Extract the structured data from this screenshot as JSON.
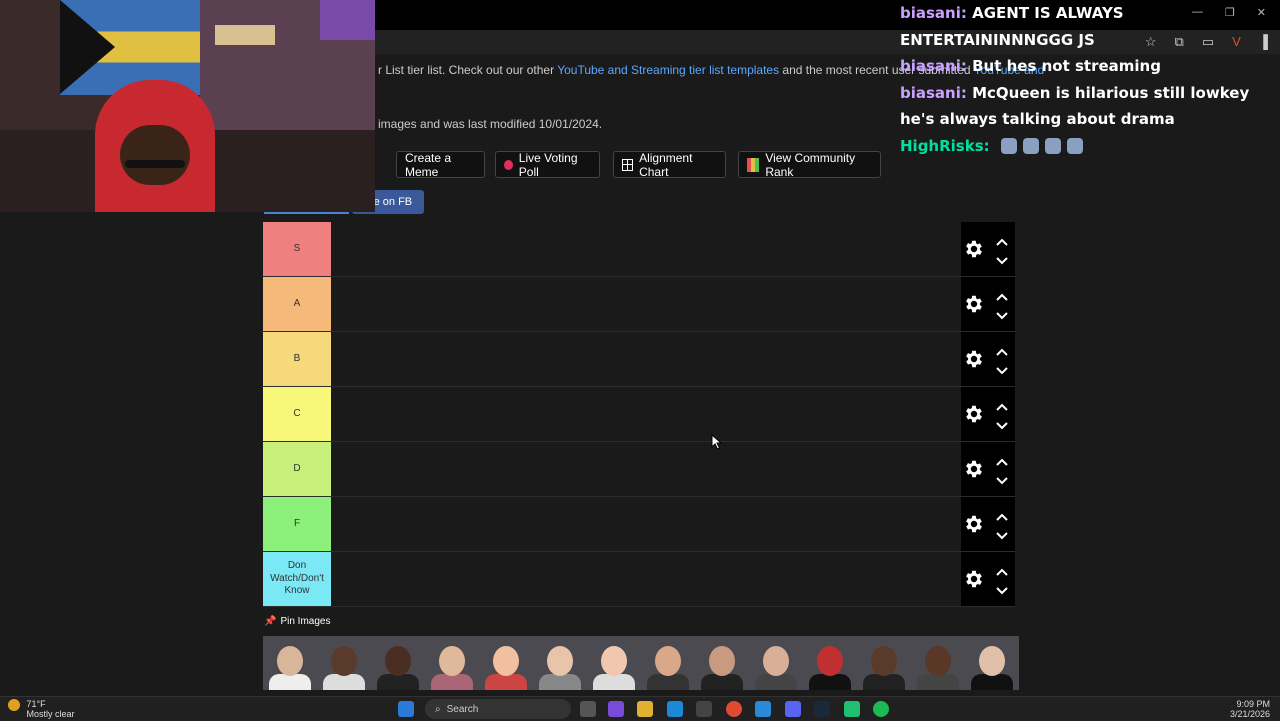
{
  "page": {
    "intro_prefix": "r List tier list. Check out our other ",
    "intro_link1": "YouTube and Streaming tier list templates",
    "intro_mid": " and the most recent user submitted ",
    "intro_link2": "YouTube and",
    "meta_text": "images and was last modified 10/01/2024."
  },
  "buttons": {
    "create_meme": "Create a Meme",
    "live_poll": "Live Voting Poll",
    "alignment": "Alignment Chart",
    "community_rank": "View Community Rank",
    "share_fb": "are on FB"
  },
  "tiers": [
    {
      "label": "S",
      "color": "#f08080"
    },
    {
      "label": "A",
      "color": "#f5b97a"
    },
    {
      "label": "B",
      "color": "#f5d97a"
    },
    {
      "label": "C",
      "color": "#f7f77a"
    },
    {
      "label": "D",
      "color": "#c9f07a"
    },
    {
      "label": "F",
      "color": "#8cf07a"
    },
    {
      "label": "Don Watch/Don't Know",
      "color": "#7ae8f5"
    }
  ],
  "pin_images": {
    "label": "Pin Images",
    "thumbs": [
      {
        "skin": "#d9b59a",
        "shirt": "#eee"
      },
      {
        "skin": "#5a3a2a",
        "shirt": "#ddd"
      },
      {
        "skin": "#4a2e22",
        "shirt": "#222"
      },
      {
        "skin": "#e0b89a",
        "shirt": "#a67"
      },
      {
        "skin": "#f0c0a0",
        "shirt": "#c44"
      },
      {
        "skin": "#e8c4a8",
        "shirt": "#888"
      },
      {
        "skin": "#f0c8b0",
        "shirt": "#ddd"
      },
      {
        "skin": "#d8a888",
        "shirt": "#333"
      },
      {
        "skin": "#c89a80",
        "shirt": "#222"
      },
      {
        "skin": "#d8b098",
        "shirt": "#444"
      },
      {
        "skin": "#c03030",
        "shirt": "#111"
      },
      {
        "skin": "#5a3a28",
        "shirt": "#222"
      },
      {
        "skin": "#5a3828",
        "shirt": "#444"
      },
      {
        "skin": "#e0c0a8",
        "shirt": "#111"
      }
    ]
  },
  "chat": [
    {
      "user": "biasani",
      "color": "#c8a2ff",
      "text": "AGENT IS ALWAYS ENTERTAININNNGGG JS"
    },
    {
      "user": "biasani",
      "color": "#c8a2ff",
      "text": "But hes not streaming"
    },
    {
      "user": "biasani",
      "color": "#c8a2ff",
      "text": "McQueen is hilarious still lowkey"
    },
    {
      "user": "",
      "color": "#fff",
      "text": "he's always talking about drama"
    },
    {
      "user": "HighRisks",
      "color": "#00e0a0",
      "text": ""
    }
  ],
  "taskbar": {
    "temperature": "71°F",
    "weather": "Mostly clear",
    "search": "Search",
    "time": "9:09 PM",
    "date": "3/21/2026"
  }
}
